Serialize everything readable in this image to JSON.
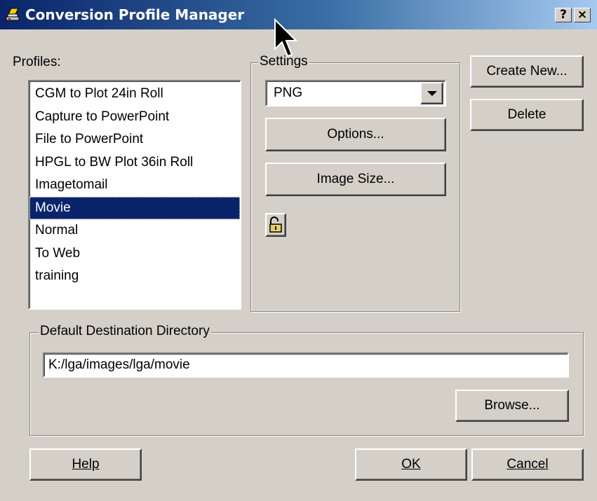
{
  "window": {
    "title": "Conversion Profile Manager",
    "help_button": "?",
    "close_button": "×"
  },
  "profiles": {
    "label": "Profiles:",
    "items": [
      "CGM to Plot 24in Roll",
      "Capture to PowerPoint",
      "File to PowerPoint",
      "HPGL to BW Plot 36in Roll",
      "Imagetomail",
      "Movie",
      "Normal",
      "To Web",
      "training"
    ],
    "selected": "Movie"
  },
  "settings": {
    "label": "Settings",
    "format_value": "PNG",
    "options_label": "Options...",
    "image_size_label": "Image Size..."
  },
  "actions": {
    "create_new_label": "Create New...",
    "delete_label": "Delete"
  },
  "destination": {
    "label": "Default Destination Directory",
    "path": "K:/lga/images/lga/movie",
    "browse_label": "Browse..."
  },
  "footer": {
    "help_label": "Help",
    "ok_label": "OK",
    "cancel_label": "Cancel"
  }
}
